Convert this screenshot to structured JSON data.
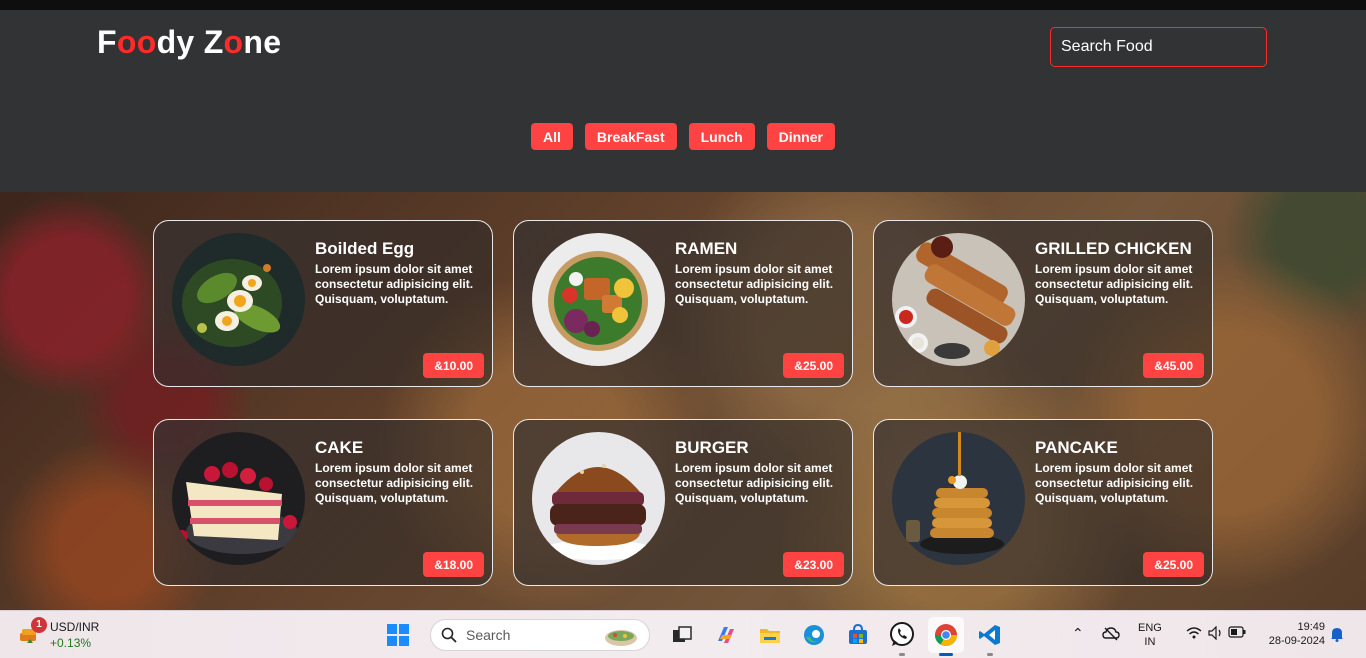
{
  "header": {
    "logo": {
      "parts": [
        {
          "text": "F",
          "red": false
        },
        {
          "text": "oo",
          "red": true
        },
        {
          "text": "dy Z",
          "red": false
        },
        {
          "text": "o",
          "red": true
        },
        {
          "text": "ne",
          "red": false
        }
      ]
    },
    "search": {
      "placeholder": "Search Food"
    },
    "filters": [
      "All",
      "BreakFast",
      "Lunch",
      "Dinner"
    ]
  },
  "foods": [
    {
      "name": "Boilded Egg",
      "description": "Lorem ipsum dolor sit amet consectetur adipisicing elit. Quisquam, voluptatum.",
      "price": "&10.00",
      "image": "egg-salad-image"
    },
    {
      "name": "RAMEN",
      "description": "Lorem ipsum dolor sit amet consectetur adipisicing elit. Quisquam, voluptatum.",
      "price": "&25.00",
      "image": "ramen-bowl-image"
    },
    {
      "name": "GRILLED CHICKEN",
      "description": "Lorem ipsum dolor sit amet consectetur adipisicing elit. Quisquam, voluptatum.",
      "price": "&45.00",
      "image": "grilled-chicken-image"
    },
    {
      "name": "CAKE",
      "description": "Lorem ipsum dolor sit amet consectetur adipisicing elit. Quisquam, voluptatum.",
      "price": "&18.00",
      "image": "cake-image"
    },
    {
      "name": "BURGER",
      "description": "Lorem ipsum dolor sit amet consectetur adipisicing elit. Quisquam, voluptatum.",
      "price": "&23.00",
      "image": "burger-image"
    },
    {
      "name": "PANCAKE",
      "description": "Lorem ipsum dolor sit amet consectetur adipisicing elit. Quisquam, voluptatum.",
      "price": "&25.00",
      "image": "pancake-image"
    }
  ],
  "colors": {
    "accent": "#ff4343",
    "header_bg": "#323334"
  },
  "taskbar": {
    "widget": {
      "ticker": "USD/INR",
      "change": "+0.13%",
      "badge": "1"
    },
    "search_label": "Search",
    "apps": [
      "start-icon",
      "search",
      "task-view-icon",
      "copilot-icon",
      "file-explorer-icon",
      "edge-icon",
      "store-icon",
      "whatsapp-icon",
      "chrome-icon",
      "vscode-icon"
    ],
    "tray": {
      "lang_line1": "ENG",
      "lang_line2": "IN",
      "time": "19:49",
      "date": "28-09-2024"
    }
  }
}
